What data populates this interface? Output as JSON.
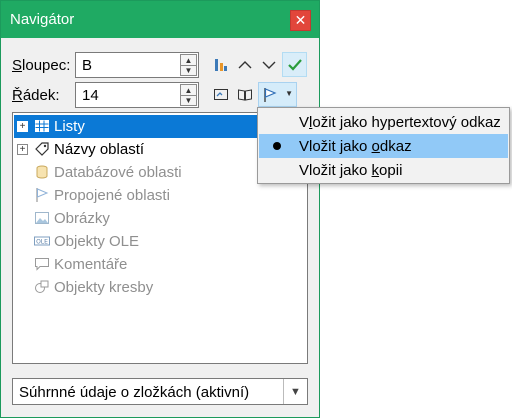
{
  "window": {
    "title": "Navigátor",
    "close_glyph": "✕"
  },
  "column": {
    "label_mnemonic": "S",
    "label_rest": "loupec:",
    "value": "B"
  },
  "row": {
    "label_mnemonic": "Ř",
    "label_rest": "ádek:",
    "value": "14"
  },
  "tree": {
    "items": [
      {
        "label": "Listy",
        "icon": "sheet-icon",
        "selected": true,
        "expandable": true
      },
      {
        "label": "Názvy oblastí",
        "icon": "tag-icon",
        "expandable": true
      },
      {
        "label": "Databázové oblasti",
        "icon": "database-icon",
        "disabled": true
      },
      {
        "label": "Propojené oblasti",
        "icon": "flag-icon",
        "disabled": true
      },
      {
        "label": "Obrázky",
        "icon": "image-icon",
        "disabled": true
      },
      {
        "label": "Objekty OLE",
        "icon": "ole-icon",
        "disabled": true
      },
      {
        "label": "Komentáře",
        "icon": "comment-icon",
        "disabled": true
      },
      {
        "label": "Objekty kresby",
        "icon": "drawing-icon",
        "disabled": true
      }
    ]
  },
  "document_select": {
    "value": "Súhrnné údaje o zložkách (aktivní)"
  },
  "drag_mode_menu": {
    "items": [
      {
        "pre": "V",
        "ul": "l",
        "post": "ožit jako hypertextový odkaz",
        "checked": false
      },
      {
        "pre": "Vložit jako ",
        "ul": "o",
        "post": "dkaz",
        "checked": true
      },
      {
        "pre": "Vložit jako ",
        "ul": "k",
        "post": "opii",
        "checked": false
      }
    ]
  },
  "colors": {
    "titlebar": "#1faa63",
    "selection": "#0b79d6",
    "menu_highlight": "#91c9f7",
    "close": "#e2463b"
  }
}
